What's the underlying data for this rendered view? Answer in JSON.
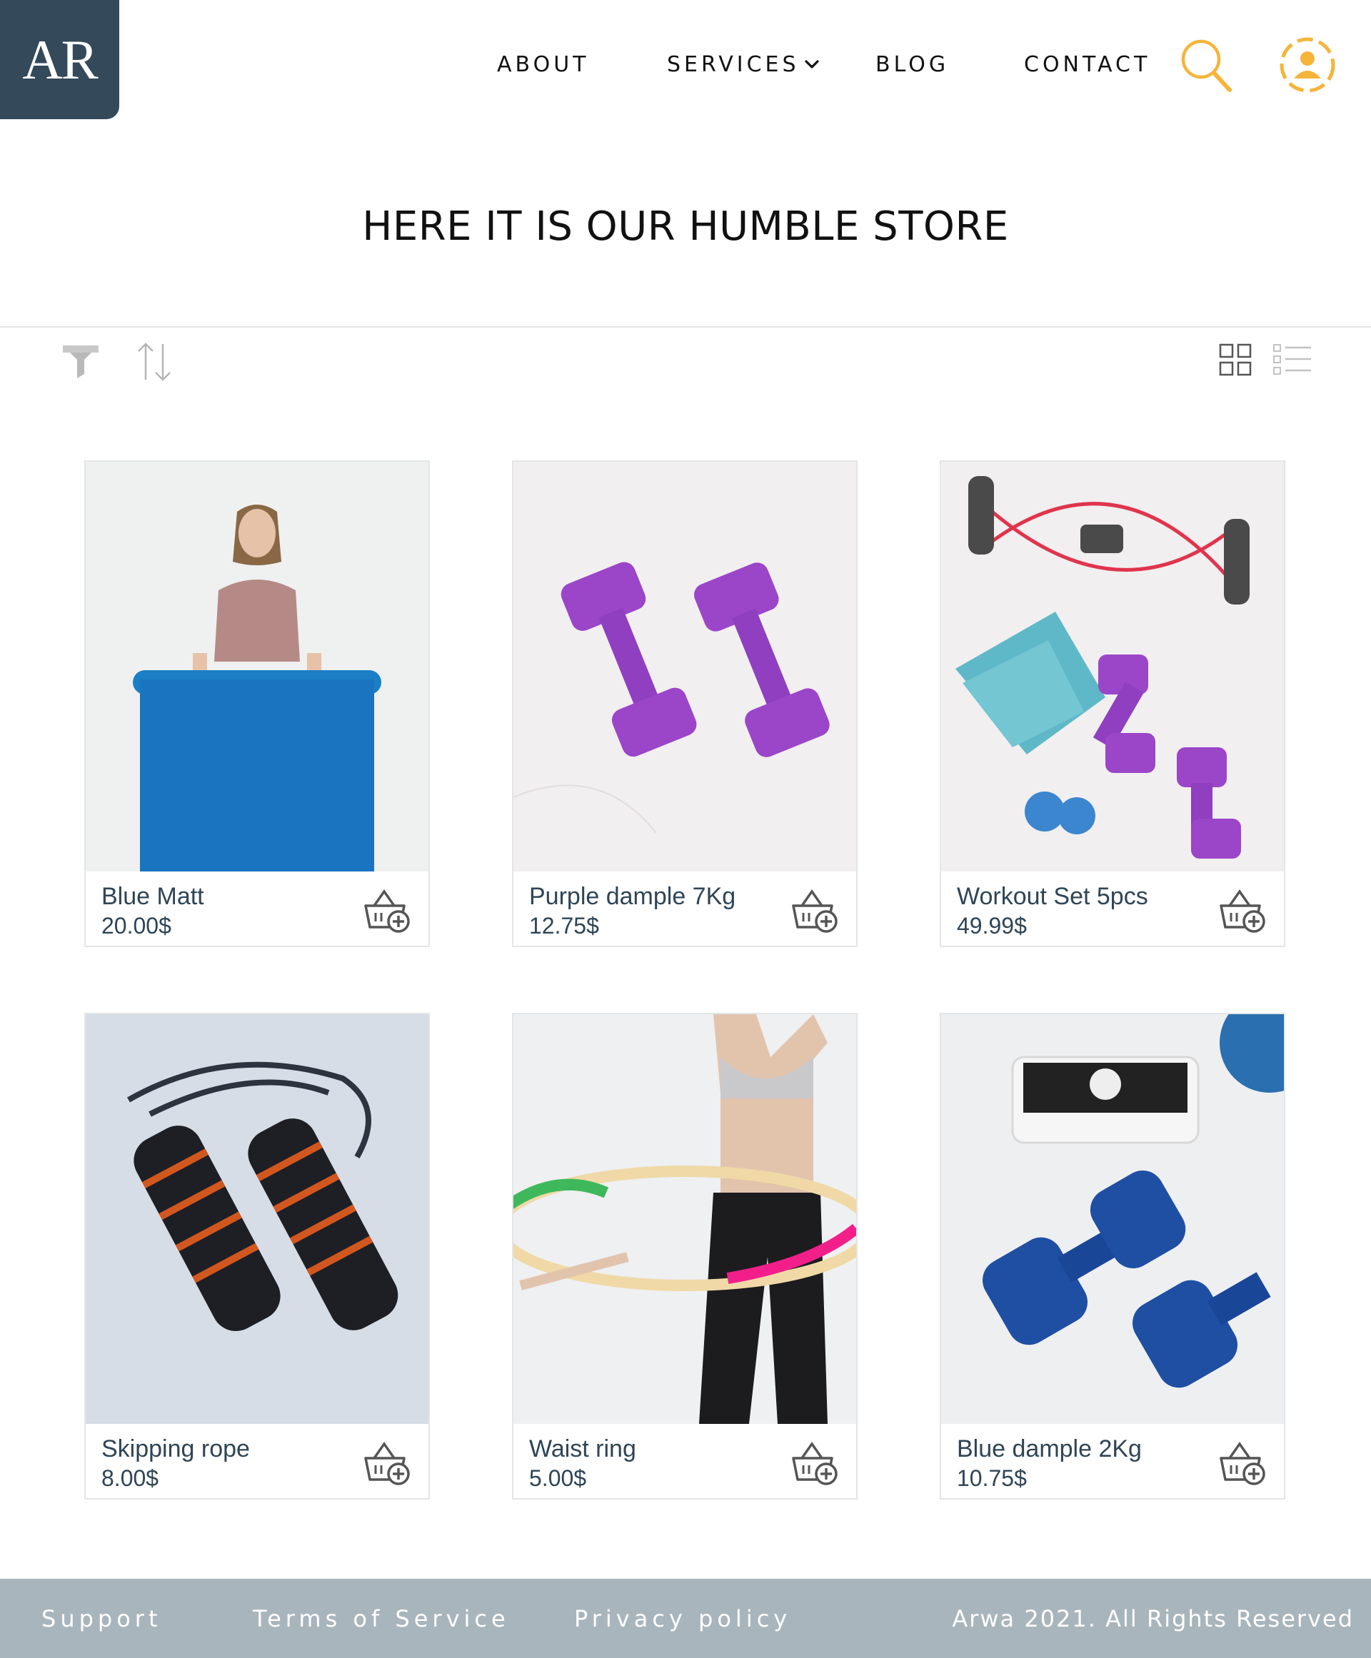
{
  "brand": {
    "logo_text": "AR"
  },
  "nav": {
    "items": [
      {
        "label": "ABOUT"
      },
      {
        "label": "SERVICES"
      },
      {
        "label": "BLOG"
      },
      {
        "label": "CONTACT"
      }
    ],
    "icons": [
      "search-icon",
      "user-profile-icon"
    ],
    "accent": "#f5b43a"
  },
  "main": {
    "title": "HERE IT IS OUR HUMBLE STORE"
  },
  "toolbar": {
    "icons": [
      "filter-icon",
      "sort-icon",
      "grid-view-icon",
      "list-view-icon"
    ]
  },
  "products": [
    {
      "name": "Blue Matt",
      "price": "20.00$"
    },
    {
      "name": "Purple dample 7Kg",
      "price": "12.75$"
    },
    {
      "name": "Workout Set 5pcs",
      "price": "49.99$"
    },
    {
      "name": "Skipping rope",
      "price": "8.00$"
    },
    {
      "name": "Waist ring",
      "price": "5.00$"
    },
    {
      "name": "Blue dample 2Kg",
      "price": "10.75$"
    }
  ],
  "footer": {
    "links": [
      {
        "label": "Support"
      },
      {
        "label": "Terms of Service"
      },
      {
        "label": "Privacy policy"
      }
    ],
    "copyright": "Arwa 2021. All Rights Reserved",
    "background": "#a9b5bc"
  },
  "colors": {
    "logo_bg": "#34495a",
    "text_dark": "#2f4556"
  }
}
